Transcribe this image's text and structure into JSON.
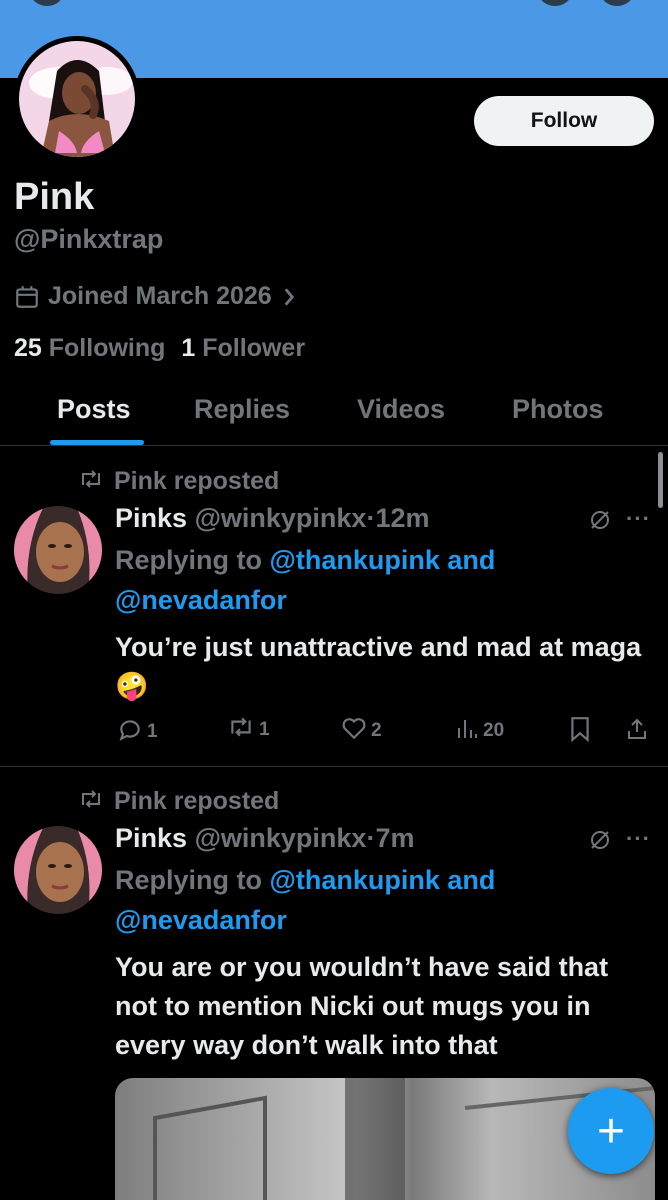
{
  "header": {
    "banner_color": "#4a98e6"
  },
  "profile": {
    "display_name": "Pink",
    "handle": "@Pinkxtrap",
    "joined": "Joined March 2026",
    "following_count": "25",
    "following_label": "Following",
    "followers_count": "1",
    "followers_label": "Follower",
    "follow_label": "Follow"
  },
  "tabs": [
    {
      "label": "Posts",
      "active": true
    },
    {
      "label": "Replies",
      "active": false
    },
    {
      "label": "Videos",
      "active": false
    },
    {
      "label": "Photos",
      "active": false
    }
  ],
  "posts": [
    {
      "repost_label": "Pink reposted",
      "author_name": "Pinks",
      "author_handle": "@winkypinkx",
      "separator": "·",
      "time": "12m",
      "replying_prefix": "Replying to",
      "mention_1": "@thankupink",
      "and": "and",
      "mention_2": "@nevadanfor",
      "text": "You’re just unattractive and mad at maga 🤪",
      "replies": "1",
      "reposts": "1",
      "likes": "2",
      "views": "20"
    },
    {
      "repost_label": "Pink reposted",
      "author_name": "Pinks",
      "author_handle": "@winkypinkx",
      "separator": "·",
      "time": "7m",
      "replying_prefix": "Replying to",
      "mention_1": "@thankupink",
      "and": "and",
      "mention_2": "@nevadanfor",
      "text": "You are or you wouldn’t have said that not to mention Nicki out mugs you in every way don’t walk into that"
    }
  ],
  "fab": {
    "label": "+"
  },
  "colors": {
    "accent": "#1d9bf0",
    "muted": "#71767b",
    "text": "#e7e9ea"
  }
}
